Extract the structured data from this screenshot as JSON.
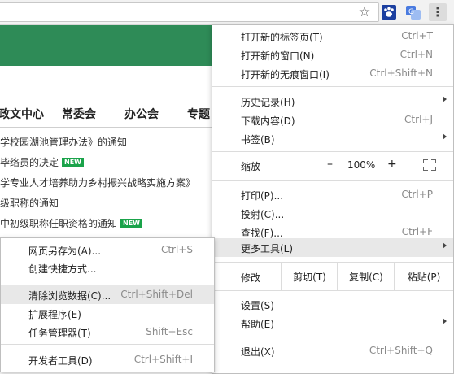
{
  "toolbar": {
    "icons": [
      "bookmark-star-icon",
      "paw-extension-icon",
      "translate-extension-icon",
      "kebab-menu-icon"
    ],
    "star_glyph": "☆",
    "kebab_glyph": "⋮"
  },
  "page": {
    "banner_color": "#2e8b57",
    "nav": [
      "政文中心",
      "常委会",
      "办公会",
      "专题"
    ],
    "news": [
      {
        "text": "学校园湖池管理办法》的通知",
        "is_new": false
      },
      {
        "text": "毕络员的决定",
        "is_new": true
      },
      {
        "text": "学专业人才培养助力乡村振兴战略实施方案》",
        "is_new": false
      },
      {
        "text": "级职称的通知",
        "is_new": false
      },
      {
        "text": "中初级职称任职资格的通知",
        "is_new": true
      }
    ],
    "new_badge": "NEW"
  },
  "menu": {
    "new_tab": {
      "label": "打开新的标签页(T)",
      "shortcut": "Ctrl+T"
    },
    "new_window": {
      "label": "打开新的窗口(N)",
      "shortcut": "Ctrl+N"
    },
    "incognito": {
      "label": "打开新的无痕窗口(I)",
      "shortcut": "Ctrl+Shift+N"
    },
    "history": {
      "label": "历史记录(H)"
    },
    "downloads": {
      "label": "下载内容(D)",
      "shortcut": "Ctrl+J"
    },
    "bookmarks": {
      "label": "书签(B)"
    },
    "zoom": {
      "label": "缩放",
      "minus": "–",
      "value": "100%",
      "plus": "+"
    },
    "print": {
      "label": "打印(P)...",
      "shortcut": "Ctrl+P"
    },
    "cast": {
      "label": "投射(C)..."
    },
    "find": {
      "label": "查找(F)...",
      "shortcut": "Ctrl+F"
    },
    "more_tools": {
      "label": "更多工具(L)"
    },
    "edit": {
      "label": "修改",
      "cut": "剪切(T)",
      "copy": "复制(C)",
      "paste": "粘贴(P)"
    },
    "settings": {
      "label": "设置(S)"
    },
    "help": {
      "label": "帮助(E)"
    },
    "exit": {
      "label": "退出(X)",
      "shortcut": "Ctrl+Shift+Q"
    }
  },
  "submenu": {
    "save_page": {
      "label": "网页另存为(A)...",
      "shortcut": "Ctrl+S"
    },
    "create_shortcut": {
      "label": "创建快捷方式..."
    },
    "clear_data": {
      "label": "清除浏览数据(C)...",
      "shortcut": "Ctrl+Shift+Del"
    },
    "extensions": {
      "label": "扩展程序(E)"
    },
    "task_manager": {
      "label": "任务管理器(T)",
      "shortcut": "Shift+Esc"
    },
    "dev_tools": {
      "label": "开发者工具(D)",
      "shortcut": "Ctrl+Shift+I"
    }
  }
}
